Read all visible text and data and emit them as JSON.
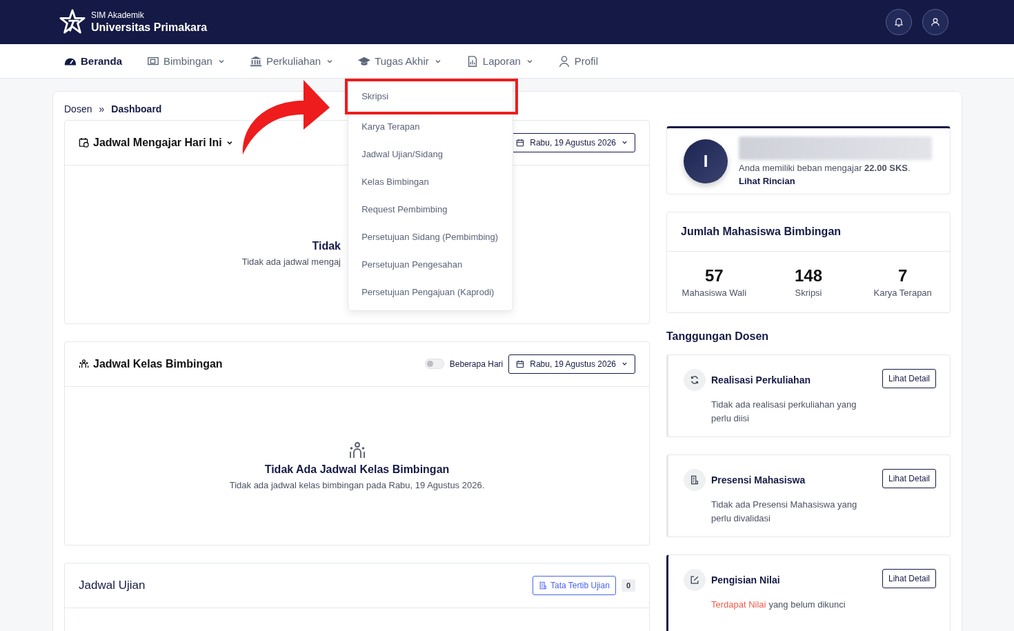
{
  "brand": {
    "subtitle": "SIM Akademik",
    "title": "Universitas Primakara"
  },
  "nav": [
    {
      "label": "Beranda",
      "selected": true,
      "kind": "link"
    },
    {
      "label": "Bimbingan",
      "selected": false,
      "kind": "dropdown"
    },
    {
      "label": "Perkuliahan",
      "selected": false,
      "kind": "dropdown"
    },
    {
      "label": "Tugas Akhir",
      "selected": false,
      "kind": "dropdown",
      "menu": [
        {
          "label": "Skripsi",
          "annotated": true
        },
        {
          "label": "Karya Terapan",
          "annotated": false
        },
        {
          "label": "Jadwal Ujian/Sidang",
          "annotated": false
        },
        {
          "label": "Kelas Bimbingan",
          "annotated": false
        },
        {
          "label": "Request Pembimbing",
          "annotated": false
        },
        {
          "label": "Persetujuan Sidang (Pembimbing)",
          "annotated": false
        },
        {
          "label": "Persetujuan Pengesahan",
          "annotated": false
        },
        {
          "label": "Persetujuan Pengajuan (Kaprodi)",
          "annotated": false
        }
      ]
    },
    {
      "label": "Laporan",
      "selected": false,
      "kind": "dropdown"
    },
    {
      "label": "Profil",
      "selected": false,
      "kind": "link"
    }
  ],
  "breadcrumb": [
    "Dosen",
    "»",
    "Dashboard"
  ],
  "schedule_card": {
    "title": "Jadwal Mengajar Hari Ini",
    "date": "Rabu, 19 Agustus 2026",
    "empty_title": "Tidak",
    "empty_text": "Tidak ada jadwal mengaj"
  },
  "guidance_card": {
    "title": "Jadwal Kelas Bimbingan",
    "toggle": {
      "label": "Beberapa Hari",
      "on": false
    },
    "date": "Rabu, 19 Agustus 2026",
    "empty_title": "Tidak Ada Jadwal Kelas Bimbingan",
    "empty_text": "Tidak ada jadwal kelas bimbingan pada Rabu, 19 Agustus 2026."
  },
  "exam_card": {
    "title": "Jadwal Ujian",
    "button": "Tata Tertib Ujian",
    "count": "0"
  },
  "profile": {
    "initial": "I",
    "load_text": "Anda memiliki beban mengajar **22.00 SKS**.",
    "link": "Lihat Rincian"
  },
  "stats": {
    "title": "Jumlah Mahasiswa Bimbingan",
    "items": [
      {
        "value": "57",
        "label": "Mahasiswa Wali"
      },
      {
        "value": "148",
        "label": "Skripsi"
      },
      {
        "value": "7",
        "label": "Karya Terapan"
      }
    ]
  },
  "tasks_title": "Tanggungan Dosen",
  "tasks": [
    {
      "title": "Realisasi Perkuliahan",
      "description": "Tidak ada realisasi perkuliahan yang perlu diisi",
      "button": "Lihat Detail",
      "color": "#e5e7eb"
    },
    {
      "title": "Presensi Mahasiswa",
      "description": "Tidak ada Presensi Mahasiswa yang perlu divalidasi",
      "button": "Lihat Detail",
      "color": "#e5e7eb"
    },
    {
      "title": "Pengisian Nilai",
      "alert": "Terdapat Nilai",
      "description": "yang belum dikunci",
      "button": "Lihat Detail",
      "color": "#141a45"
    }
  ]
}
